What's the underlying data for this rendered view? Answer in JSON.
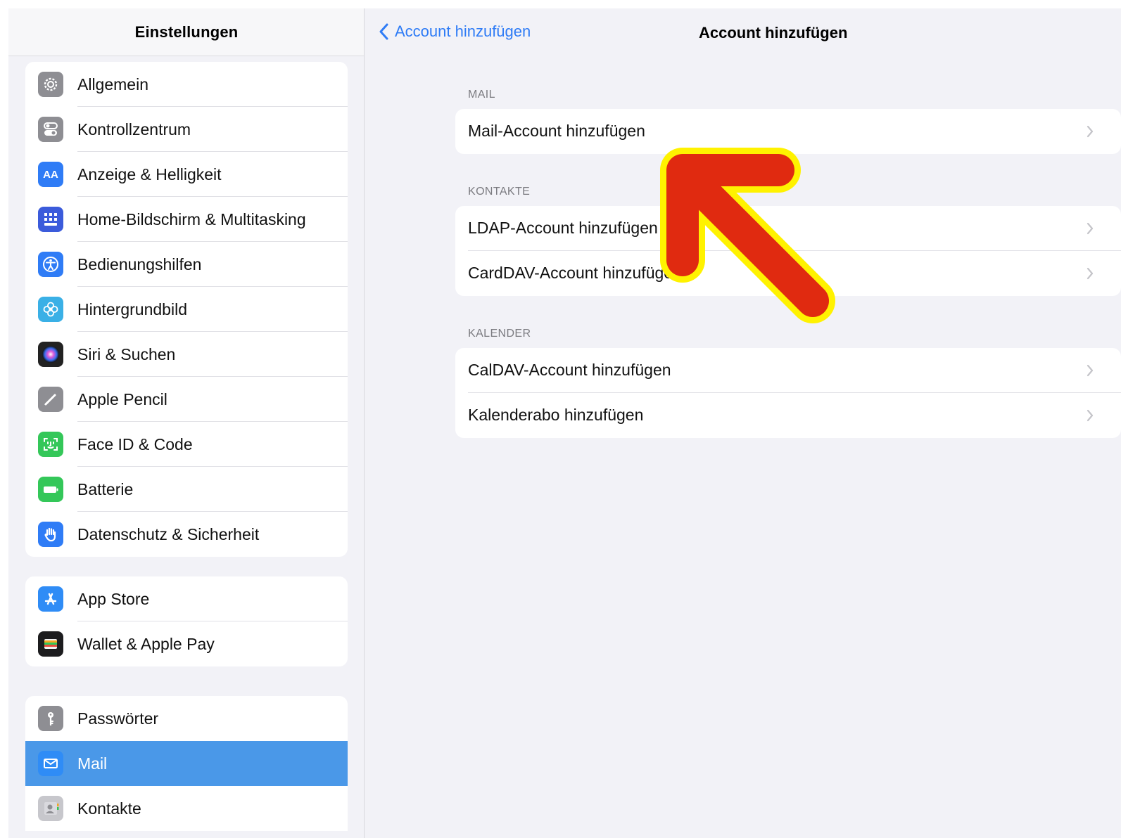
{
  "sidebar": {
    "title": "Einstellungen",
    "groups": [
      {
        "items": [
          {
            "label": "Allgemein",
            "icon": "gear-icon",
            "color": "#8e8e93"
          },
          {
            "label": "Kontrollzentrum",
            "icon": "toggles-icon",
            "color": "#8e8e93"
          },
          {
            "label": "Anzeige & Helligkeit",
            "icon": "text-size-icon",
            "color": "#2f7cf6"
          },
          {
            "label": "Home-Bildschirm & Multitasking",
            "icon": "grid-icon",
            "color": "#3b5bdb"
          },
          {
            "label": "Bedienungshilfen",
            "icon": "accessibility-icon",
            "color": "#2f7cf6"
          },
          {
            "label": "Hintergrundbild",
            "icon": "flower-icon",
            "color": "#3ab0e6"
          },
          {
            "label": "Siri & Suchen",
            "icon": "siri-icon",
            "color": "#222222"
          },
          {
            "label": "Apple Pencil",
            "icon": "pencil-icon",
            "color": "#8e8e93"
          },
          {
            "label": "Face ID & Code",
            "icon": "face-id-icon",
            "color": "#34c759"
          },
          {
            "label": "Batterie",
            "icon": "battery-icon",
            "color": "#34c759"
          },
          {
            "label": "Datenschutz & Sicherheit",
            "icon": "hand-icon",
            "color": "#2f7cf6"
          }
        ]
      },
      {
        "items": [
          {
            "label": "App Store",
            "icon": "app-store-icon",
            "color": "#2f8cf6"
          },
          {
            "label": "Wallet & Apple Pay",
            "icon": "wallet-icon",
            "color": "#1c1c1e"
          }
        ]
      },
      {
        "items": [
          {
            "label": "Passwörter",
            "icon": "key-icon",
            "color": "#8e8e93"
          },
          {
            "label": "Mail",
            "icon": "mail-icon",
            "color": "#2f8cf6",
            "selected": true
          },
          {
            "label": "Kontakte",
            "icon": "contacts-icon",
            "color": "#a8a8ad"
          }
        ]
      }
    ]
  },
  "detail": {
    "back_label": "Account hinzufügen",
    "title": "Account hinzufügen",
    "sections": [
      {
        "header": "MAIL",
        "items": [
          "Mail-Account hinzufügen"
        ]
      },
      {
        "header": "KONTAKTE",
        "items": [
          "LDAP-Account hinzufügen",
          "CardDAV-Account hinzufügen"
        ]
      },
      {
        "header": "KALENDER",
        "items": [
          "CalDAV-Account hinzufügen",
          "Kalenderabo hinzufügen"
        ]
      }
    ]
  },
  "colors": {
    "accent": "#2f7cf6",
    "selected_row": "#4a98e8",
    "annotation_arrow": "#e02a10",
    "annotation_outline": "#fff200"
  }
}
